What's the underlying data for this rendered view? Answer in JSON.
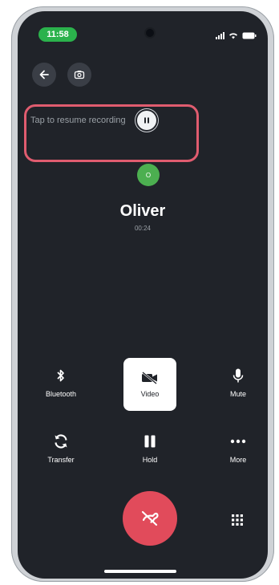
{
  "status_bar": {
    "time": "11:58"
  },
  "recording": {
    "text": "Tap to resume recording"
  },
  "caller": {
    "avatar_text": "O",
    "name": "Oliver",
    "duration": "00:24"
  },
  "controls": {
    "bluetooth": "Bluetooth",
    "video": "Video",
    "mute": "Mute",
    "transfer": "Transfer",
    "hold": "Hold",
    "more": "More"
  },
  "icons": {
    "back": "arrow-left",
    "screenshot": "camera",
    "pause": "pause",
    "end_call": "phone-hangup",
    "keypad": "keypad"
  },
  "colors": {
    "background": "#202329",
    "recording_highlight": "#e05c6f",
    "end_call": "#e14b5b",
    "avatar": "#4caf50",
    "time_pill": "#2bb24c"
  }
}
